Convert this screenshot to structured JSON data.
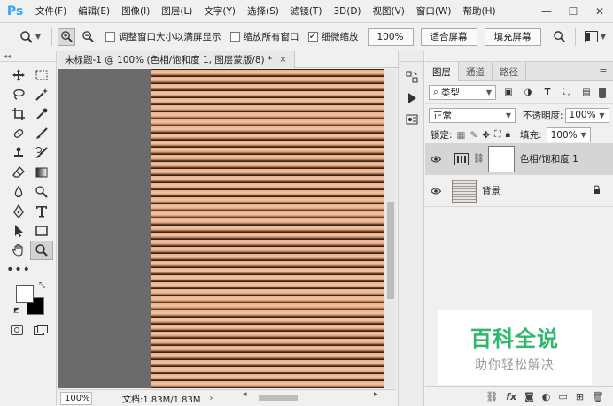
{
  "app": {
    "logo": "Ps"
  },
  "menu": [
    "文件(F)",
    "编辑(E)",
    "图像(I)",
    "图层(L)",
    "文字(Y)",
    "选择(S)",
    "滤镜(T)",
    "3D(D)",
    "视图(V)",
    "窗口(W)",
    "帮助(H)"
  ],
  "window_controls": {
    "minimize": "—",
    "maximize": "☐",
    "close": "✕"
  },
  "options": {
    "resize_window": "调整窗口大小以满屏显示",
    "zoom_all": "缩放所有窗口",
    "scrubby_zoom": "细微缩放",
    "zoom_value": "100%",
    "fit_screen": "适合屏幕",
    "fill_screen": "填充屏幕",
    "resize_checked": false,
    "zoom_all_checked": false,
    "scrubby_checked": true
  },
  "document": {
    "tab_title": "未标题-1 @ 100% (色相/饱和度 1, 图层蒙版/8) *",
    "tab_close": "×",
    "zoom": "100%",
    "doc_info": "文档:1.83M/1.83M"
  },
  "layers_panel": {
    "tabs": [
      "图层",
      "通道",
      "路径"
    ],
    "filter_kind": "类型",
    "blend_mode": "正常",
    "opacity_label": "不透明度:",
    "opacity": "100%",
    "lock_label": "锁定:",
    "fill_label": "填充:",
    "fill": "100%",
    "layers": [
      {
        "name": "色相/饱和度 1",
        "selected": true
      },
      {
        "name": "背景",
        "selected": false
      }
    ],
    "footer_fx": "fx"
  },
  "watermark": {
    "title": "百科全说",
    "subtitle": "助你轻松解决",
    "color": "#2fb86a"
  }
}
